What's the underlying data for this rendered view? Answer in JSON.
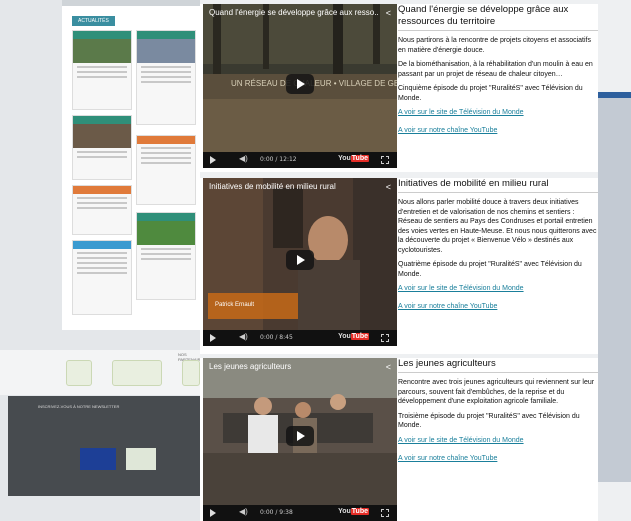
{
  "videos": [
    {
      "player_title": "Quand l'énergie se développe grâce aux resso...",
      "overlay_caption": "UN RÉSEAU DE CHALEUR • VILLAGE DE GESVES",
      "time": "0:00 / 12:12",
      "heading": "Quand l'énergie se développe grâce aux ressources du territoire",
      "paragraphs": [
        "Nous partirons à la rencontre de projets citoyens et associatifs en matière d'énergie douce.",
        "De la biométhanisation, à la réhabilitation d'un moulin à eau en passant par un projet de réseau de chaleur citoyen…",
        "Cinquième épisode du projet \"RuralitéS\" avec Télévision du Monde."
      ],
      "link_site": "A voir sur le site de Télévision du Monde",
      "link_youtube": "A voir sur notre chaîne YouTube"
    },
    {
      "player_title": "Initiatives de mobilité en milieu rural",
      "overlay_caption": "Patrick Ernault",
      "time": "0:00 / 8:45",
      "heading": "Initiatives de mobilité en milieu rural",
      "paragraphs": [
        "Nous allons parler mobilité douce à travers deux initiatives d'entretien et de valorisation de nos chemins et sentiers : Réseau de sentiers au Pays des Condruses et portail entretien des voies vertes en Haute-Meuse. Et nous nous quitterons avec la découverte du projet « Bienvenue Vélo » destinés aux cyclotouristes.",
        "Quatrième épisode du projet \"RuralitéS\" avec Télévision du Monde."
      ],
      "link_site": "A voir sur le site de Télévision du Monde",
      "link_youtube": "A voir sur notre chaîne YouTube"
    },
    {
      "player_title": "Les jeunes agriculteurs",
      "overlay_caption": "",
      "time": "0:00 / 9:38",
      "heading": "Les jeunes agriculteurs",
      "paragraphs": [
        "Rencontre avec trois jeunes agriculteurs qui reviennent sur leur parcours, souvent fait d'embûches, de la reprise et du développement d'une exploitation agricole familiale.",
        "Troisième épisode du projet \"RuralitéS\" avec Télévision du Monde."
      ],
      "link_site": "A voir sur le site de Télévision du Monde",
      "link_youtube": "A voir sur notre chaîne YouTube"
    }
  ],
  "player": {
    "youtube_label": "You",
    "youtube_badge": "Tube"
  },
  "background_site": {
    "news_title": "ACTUALITÉS",
    "partners_label": "NOS PARTENAIRES",
    "newsletter_label": "INSCRIVEZ-VOUS À NOTRE NEWSLETTER"
  },
  "colors": {
    "link": "#1a7f9b",
    "player_bg": "#000000",
    "youtube_red": "#e52d27"
  }
}
